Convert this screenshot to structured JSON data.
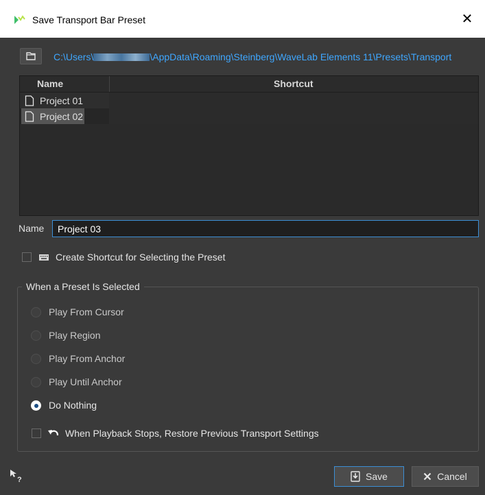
{
  "window": {
    "title": "Save Transport Bar Preset",
    "close_symbol": "✕"
  },
  "path": {
    "prefix": "C:\\Users\\",
    "suffix": "\\AppData\\Roaming\\Steinberg\\WaveLab Elements 11\\Presets\\Transport"
  },
  "table": {
    "columns": [
      "Name",
      "Shortcut"
    ],
    "rows": [
      {
        "name": "Project 01",
        "shortcut": ""
      },
      {
        "name": "Project 02",
        "shortcut": "",
        "selected": true
      }
    ]
  },
  "name_field": {
    "label": "Name",
    "value": "Project 03"
  },
  "shortcut_option": {
    "label": "Create Shortcut for Selecting the Preset",
    "checked": false
  },
  "group": {
    "legend": "When a Preset Is Selected",
    "options": [
      {
        "label": "Play From Cursor",
        "selected": false
      },
      {
        "label": "Play Region",
        "selected": false
      },
      {
        "label": "Play From Anchor",
        "selected": false
      },
      {
        "label": "Play Until Anchor",
        "selected": false
      },
      {
        "label": "Do Nothing",
        "selected": true
      }
    ],
    "restore_option": {
      "label": "When Playback Stops, Restore Previous Transport Settings",
      "checked": false
    }
  },
  "buttons": {
    "save": "Save",
    "cancel": "Cancel"
  },
  "colors": {
    "accent": "#3c8fd6",
    "path_text": "#3fa7ff",
    "panel_bg": "#3a3a3a"
  }
}
